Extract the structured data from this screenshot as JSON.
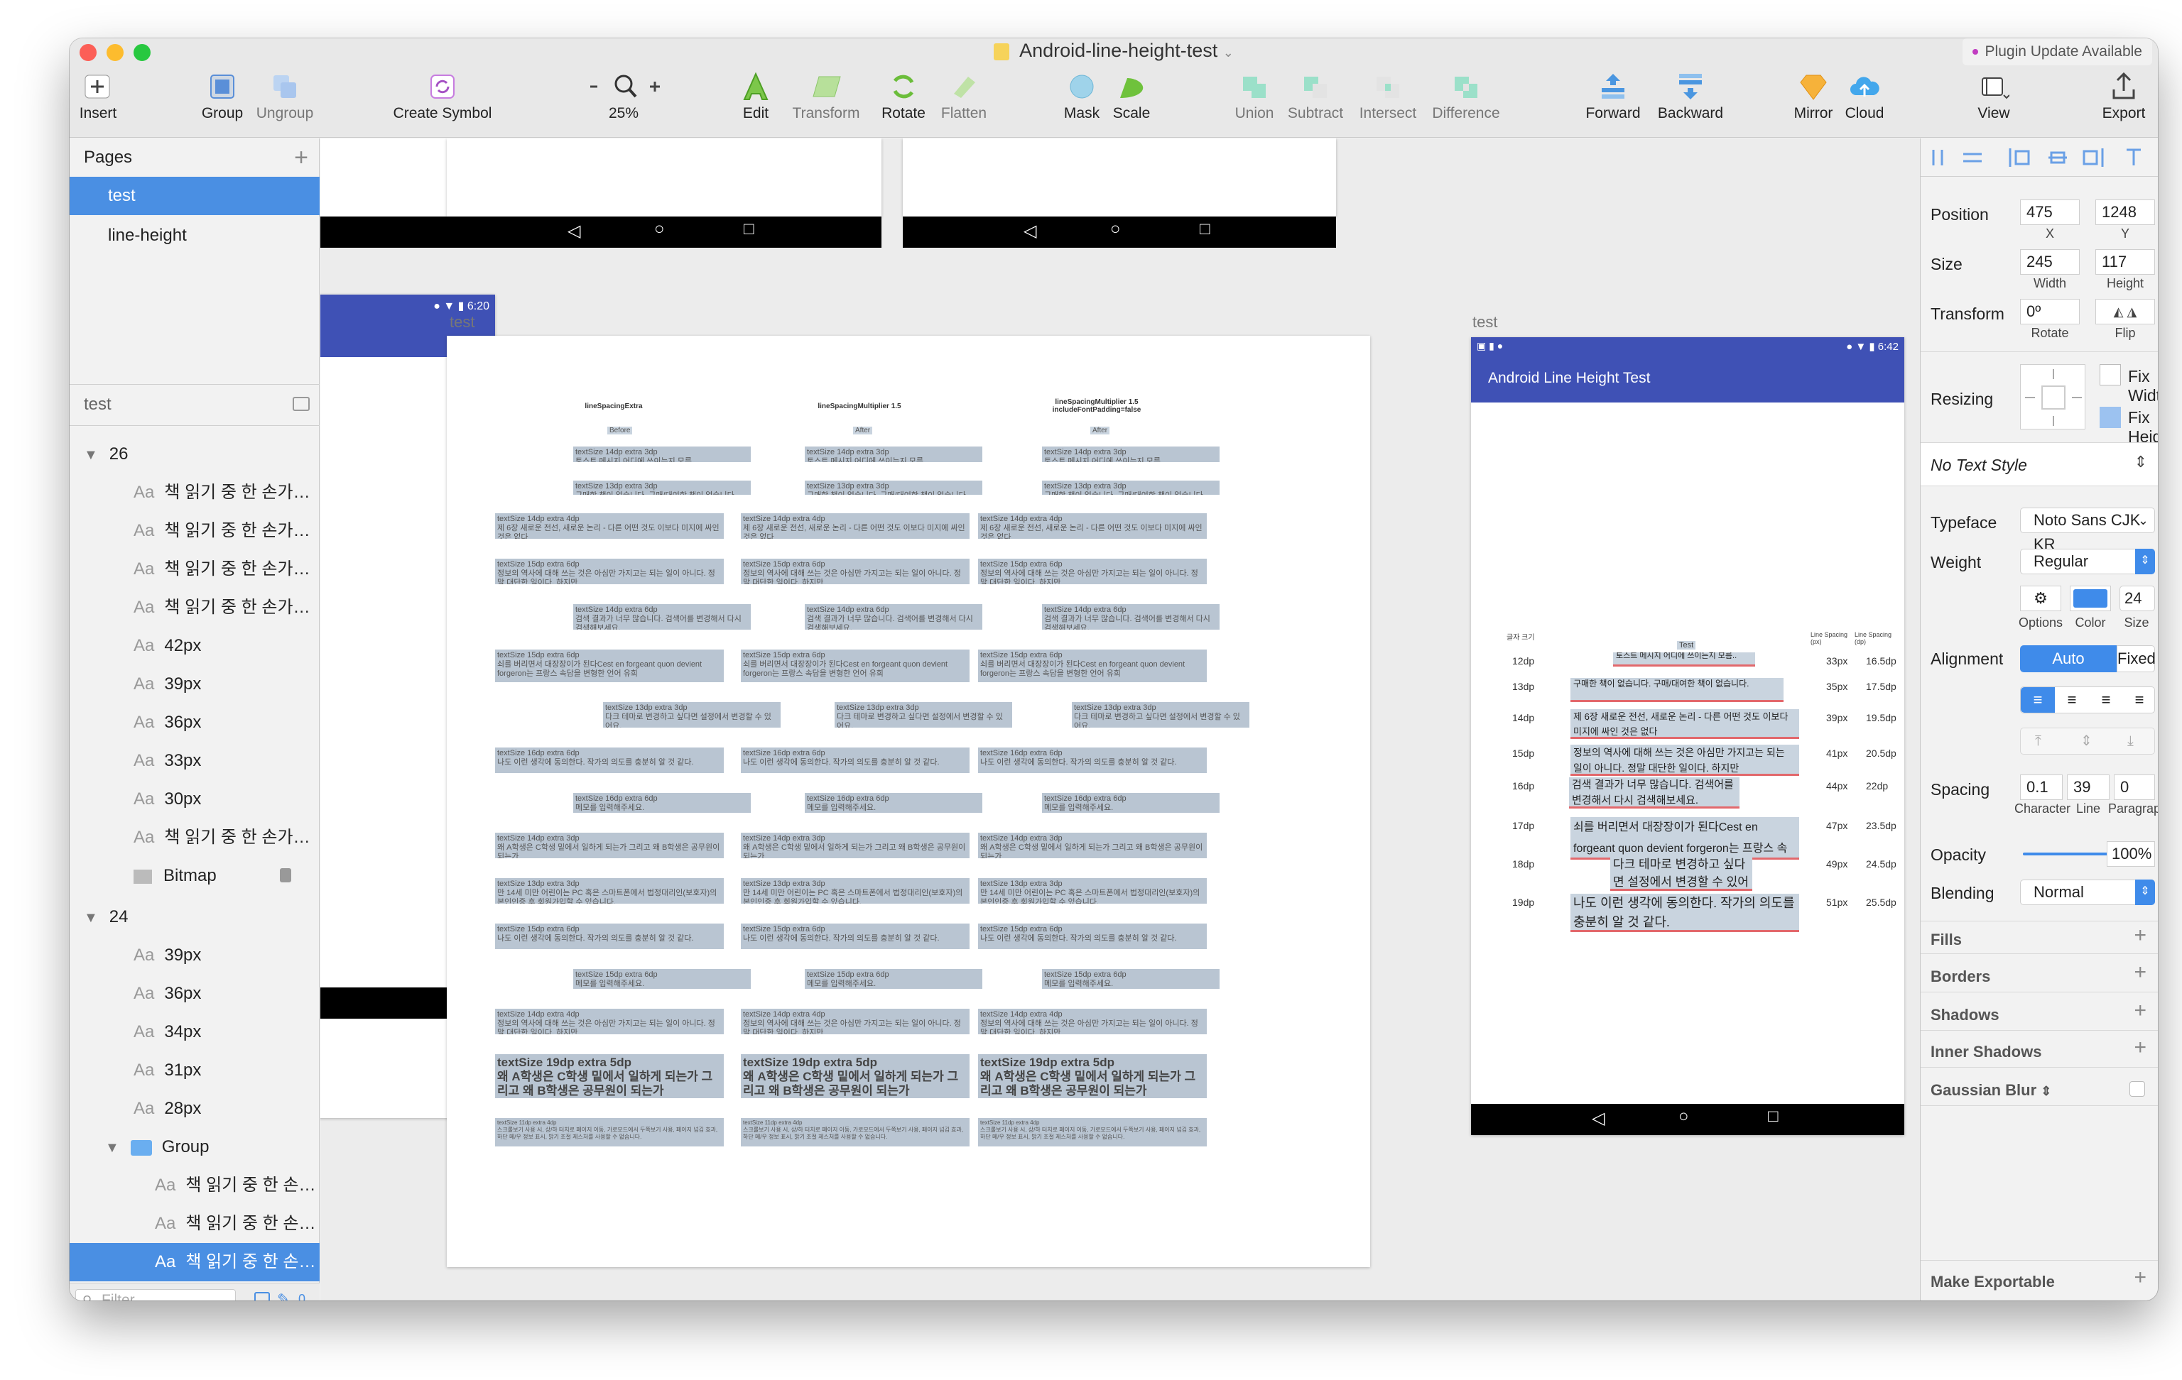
{
  "window": {
    "title": "Android-line-height-test",
    "plugin_badge": "Plugin Update Available"
  },
  "toolbar": {
    "insert": "Insert",
    "group": "Group",
    "ungroup": "Ungroup",
    "create_symbol": "Create Symbol",
    "zoom": "25%",
    "edit": "Edit",
    "transform": "Transform",
    "rotate": "Rotate",
    "flatten": "Flatten",
    "mask": "Mask",
    "scale": "Scale",
    "union": "Union",
    "subtract": "Subtract",
    "intersect": "Intersect",
    "difference": "Difference",
    "forward": "Forward",
    "backward": "Backward",
    "mirror": "Mirror",
    "cloud": "Cloud",
    "view": "View",
    "export": "Export"
  },
  "pages": {
    "header": "Pages",
    "items": [
      "test",
      "line-height"
    ],
    "selected": "test"
  },
  "layers": {
    "page_name": "test",
    "groups": [
      {
        "name": "26",
        "items": [
          "책 읽기 중 한 손가…",
          "책 읽기 중 한 손가…",
          "책 읽기 중 한 손가…",
          "책 읽기 중 한 손가…",
          "42px",
          "39px",
          "36px",
          "33px",
          "30px",
          "책 읽기 중 한 손가…",
          "Bitmap"
        ]
      },
      {
        "name": "24",
        "items": [
          "39px",
          "36px",
          "34px",
          "31px",
          "28px"
        ]
      },
      {
        "name": "Group",
        "items": [
          "책 읽기 중 한 손…",
          "책 읽기 중 한 손…",
          "책 읽기 중 한 손…"
        ]
      }
    ],
    "filter_placeholder": "Filter",
    "badge_count": "0"
  },
  "canvas": {
    "artboard_label_1": "test",
    "artboard_label_2": "test",
    "status_time_1": "6:20",
    "status_time_2": "6:42",
    "app_title": "Android Line Height Test",
    "columns": [
      {
        "header": "lineSpacingExtra",
        "tag": "Before"
      },
      {
        "header": "lineSpacingMultiplier 1.5",
        "tag": "After"
      },
      {
        "header": "lineSpacingMultiplier 1.5 includeFontPadding=false",
        "tag": "After"
      }
    ],
    "blocks": [
      {
        "title": "textSize 14dp extra 3dp",
        "body": "토스트 메시지 어디에 쓰이는지 모름.."
      },
      {
        "title": "textSize 13dp extra 3dp",
        "body": "구매한 책이 없습니다. 구매/대여한 책이 없습니다."
      },
      {
        "title": "textSize 14dp extra 4dp",
        "body": "제 6장 새로운 전선, 새로운 논리 - 다른 어떤 것도 이보다 미지에 싸인 것은 없다"
      },
      {
        "title": "textSize 15dp extra 6dp",
        "body": "정보의 역사에 대해 쓰는 것은 아심만 가지고는 되는 일이 아니다. 정말 대단한 일이다. 하지만"
      },
      {
        "title": "textSize 14dp extra 6dp",
        "body": "검색 결과가 너무 많습니다. 검색어를 변경해서 다시 검색해보세요."
      },
      {
        "title": "textSize 15dp extra 6dp",
        "body": "쇠를 버리면서 대장장이가 된다Cest en forgeant quon devient forgeron는 프랑스 속담을 변형한 언어 유희"
      },
      {
        "title": "textSize 13dp extra 3dp",
        "body": "다크 테마로 변경하고 싶다면 설정에서 변경할 수 있어요."
      },
      {
        "title": "textSize 16dp extra 6dp",
        "body": "나도 이런 생각에 동의한다. 작가의 의도를 충분히 알 것 같다."
      },
      {
        "title": "textSize 16dp extra 6dp",
        "body": "메모를 입력해주세요."
      },
      {
        "title": "textSize 14dp extra 3dp",
        "body": "왜 A학생은 C학생 밑에서 일하게 되는가 그리고 왜 B학생은 공무원이 되는가"
      },
      {
        "title": "textSize 13dp extra 3dp",
        "body": "만 14세 미만 어린이는 PC 혹은 스마트폰에서 법정대리인(보호자)의 본인인증 후 회원가입할 수 있습니다."
      },
      {
        "title": "textSize 15dp extra 6dp",
        "body": "나도 이런 생각에 동의한다. 작가의 의도를 충분히 알 것 같다."
      },
      {
        "title": "textSize 15dp extra 6dp",
        "body": "메모를 입력해주세요."
      },
      {
        "title": "textSize 14dp extra 4dp",
        "body": "정보의 역사에 대해 쓰는 것은 아심만 가지고는 되는 일이 아니다. 정말 대단한 일이다. 하지만"
      },
      {
        "title": "textSize 19dp extra 5dp",
        "body": "왜 A학생은 C학생 밑에서 일하게 되는가 그리고 왜 B학생은 공무원이 되는가"
      },
      {
        "title": "textSize 11dp extra 4dp",
        "body": "스크롤보기 사용 시, 상/하 터치로 페이지 이동, 가로모드에서 두쪽보기 사용, 페이지 넘김 효과, 하단 메/우 정보 표시, 밝기 조절 제스처를 사용할 수 없습니다."
      }
    ],
    "phone": {
      "col_left": "글자 크기",
      "col_mid": "Test",
      "col_r1": "Line Spacing (px)",
      "col_r2": "Line Spacing (dp)",
      "rows": [
        {
          "size": "12dp",
          "px": "33px",
          "dp": "16.5dp",
          "text": "토스트 메시지 어디에 쓰이는지 모름.."
        },
        {
          "size": "13dp",
          "px": "35px",
          "dp": "17.5dp",
          "text": "구매한 책이 없습니다. 구매/대여한 책이 없습니다."
        },
        {
          "size": "14dp",
          "px": "39px",
          "dp": "19.5dp",
          "text": "제 6장 새로운 전선, 새로운 논리 - 다른 어떤 것도 이보다 미지에 싸인 것은 없다"
        },
        {
          "size": "15dp",
          "px": "41px",
          "dp": "20.5dp",
          "text": "정보의 역사에 대해 쓰는 것은 아심만 가지고는 되는 일이 아니다. 정말 대단한 일이다. 하지만"
        },
        {
          "size": "16dp",
          "px": "44px",
          "dp": "22dp",
          "text": "검색 결과가 너무 많습니다. 검색어를 변경해서 다시 검색해보세요."
        },
        {
          "size": "17dp",
          "px": "47px",
          "dp": "23.5dp",
          "text": "쇠를 버리면서 대장장이가 된다Cest en forgeant quon devient forgeron는 프랑스 속담을 변형한 언어 유희"
        },
        {
          "size": "18dp",
          "px": "49px",
          "dp": "24.5dp",
          "text": "다크 테마로 변경하고 싶다면 설정에서 변경할 수 있어요."
        },
        {
          "size": "19dp",
          "px": "51px",
          "dp": "25.5dp",
          "text": "나도 이런 생각에 동의한다. 작가의 의도를 충분히 알 것 같다."
        }
      ]
    }
  },
  "inspector": {
    "position_label": "Position",
    "x": "475",
    "y": "1248",
    "x_cap": "X",
    "y_cap": "Y",
    "size_label": "Size",
    "width": "245",
    "height": "117",
    "width_cap": "Width",
    "height_cap": "Height",
    "transform_label": "Transform",
    "rotate": "0º",
    "rotate_cap": "Rotate",
    "flip_cap": "Flip",
    "resizing_label": "Resizing",
    "fix_width": "Fix Width",
    "fix_height": "Fix Height",
    "text_style": "No Text Style",
    "typeface_label": "Typeface",
    "typeface": "Noto Sans CJK KR",
    "weight_label": "Weight",
    "weight": "Regular",
    "font_size": "24",
    "options_cap": "Options",
    "color_cap": "Color",
    "size_cap": "Size",
    "alignment_label": "Alignment",
    "auto": "Auto",
    "fixed": "Fixed",
    "spacing_label": "Spacing",
    "character": "0.1",
    "line": "39",
    "paragraph": "0",
    "character_cap": "Character",
    "line_cap": "Line",
    "paragraph_cap": "Paragraph",
    "opacity_label": "Opacity",
    "opacity": "100%",
    "opacity_value": 1.0,
    "blending_label": "Blending",
    "blending": "Normal",
    "sections": [
      "Fills",
      "Borders",
      "Shadows",
      "Inner Shadows",
      "Gaussian Blur"
    ],
    "make_exportable": "Make Exportable",
    "accent": "#4a8fe3",
    "text_color": "#3f8bea"
  }
}
